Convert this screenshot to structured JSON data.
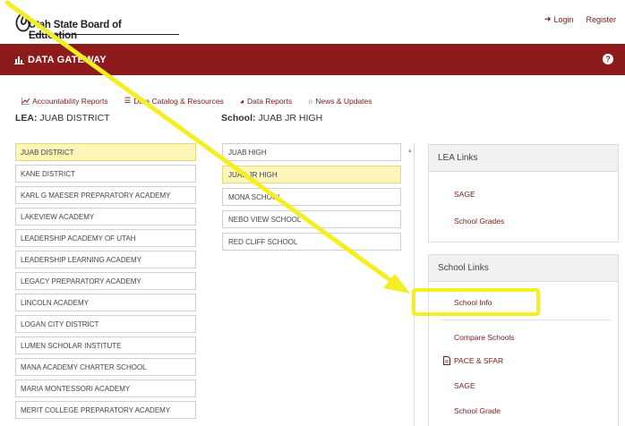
{
  "header": {
    "logo_text": "Utah State Board of Education",
    "login_label": "Login",
    "register_label": "Register"
  },
  "gateway": {
    "title": "DATA GATEWAY",
    "help": "?"
  },
  "nav": {
    "items": [
      {
        "label": "Accountability Reports",
        "icon": "chart-icon"
      },
      {
        "label": "Data Catalog & Resources",
        "icon": "list-icon"
      },
      {
        "label": "Data Reports",
        "icon": "pie-icon"
      },
      {
        "label": "News & Updates",
        "icon": "circle-icon"
      }
    ]
  },
  "lea": {
    "label": "LEA:",
    "value": "JUAB DISTRICT",
    "items": [
      "JUAB DISTRICT",
      "KANE DISTRICT",
      "KARL G MAESER PREPARATORY ACADEMY",
      "LAKEVIEW ACADEMY",
      "LEADERSHIP ACADEMY OF UTAH",
      "LEADERSHIP LEARNING ACADEMY",
      "LEGACY PREPARATORY ACADEMY",
      "LINCOLN ACADEMY",
      "LOGAN CITY DISTRICT",
      "LUMEN SCHOLAR INSTITUTE",
      "MANA ACADEMY CHARTER SCHOOL",
      "MARIA MONTESSORI ACADEMY",
      "MERIT COLLEGE PREPARATORY ACADEMY"
    ],
    "selected_index": 0
  },
  "school": {
    "label": "School:",
    "value": "JUAB JR HIGH",
    "items": [
      "JUAB HIGH",
      "JUAB JR HIGH",
      "MONA SCHOOL",
      "NEBO VIEW SCHOOL",
      "RED CLIFF SCHOOL"
    ],
    "selected_index": 1
  },
  "lea_links": {
    "title": "LEA Links",
    "items": [
      "SAGE",
      "School Grades"
    ]
  },
  "school_links": {
    "title": "School Links",
    "items": [
      {
        "label": "School Info",
        "icon": ""
      },
      {
        "label": "Compare Schools",
        "icon": ""
      },
      {
        "label": "PACE & SFAR",
        "icon": "document-icon"
      },
      {
        "label": "SAGE",
        "icon": ""
      },
      {
        "label": "School Grade",
        "icon": ""
      }
    ]
  },
  "colors": {
    "brand_red": "#8e1b1b",
    "link_red": "#7a1a1a",
    "selection_yellow": "#fdf6b8",
    "annotation_yellow": "#f4ee22"
  }
}
